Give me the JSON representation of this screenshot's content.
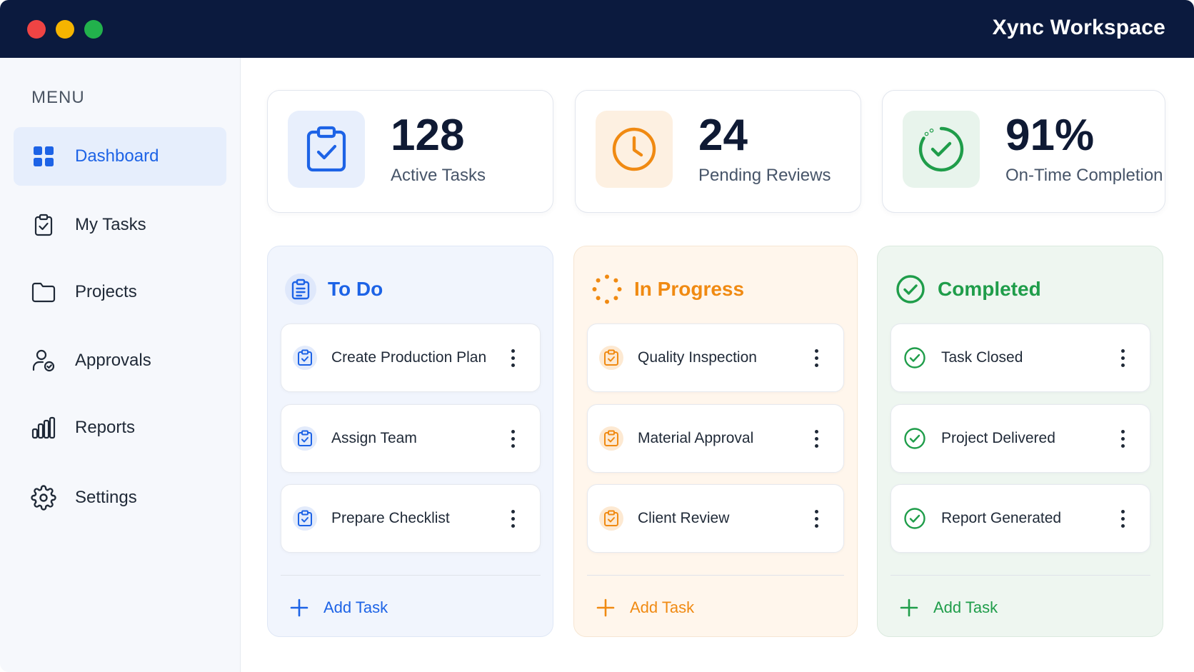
{
  "window": {
    "title": "Xync Workspace"
  },
  "sidebar": {
    "menu_label": "MENU",
    "items": [
      {
        "label": "Dashboard",
        "icon": "grid-icon",
        "active": true
      },
      {
        "label": "My Tasks",
        "icon": "clipboard-check-icon",
        "active": false
      },
      {
        "label": "Projects",
        "icon": "folder-icon",
        "active": false
      },
      {
        "label": "Approvals",
        "icon": "user-check-icon",
        "active": false
      },
      {
        "label": "Reports",
        "icon": "bar-chart-icon",
        "active": false
      },
      {
        "label": "Settings",
        "icon": "gear-icon",
        "active": false
      }
    ]
  },
  "stats": [
    {
      "value": "128",
      "label": "Active Tasks",
      "icon": "clipboard-check-icon",
      "color": "#1d63e6"
    },
    {
      "value": "24",
      "label": "Pending Reviews",
      "icon": "clock-icon",
      "color": "#f08a12"
    },
    {
      "value": "91%",
      "label": "On-Time Completion",
      "icon": "check-circle-icon",
      "color": "#1f9d4a"
    }
  ],
  "columns": [
    {
      "title": "To Do",
      "color": "#1d63e6",
      "header_icon": "clipboard-list-icon",
      "tasks": [
        "Create Production Plan",
        "Assign Team",
        "Prepare Checklist"
      ],
      "add_label": "Add Task"
    },
    {
      "title": "In Progress",
      "color": "#f08a12",
      "header_icon": "spinner-icon",
      "tasks": [
        "Quality Inspection",
        "Material Approval",
        "Client Review"
      ],
      "add_label": "Add Task"
    },
    {
      "title": "Completed",
      "color": "#1f9d4a",
      "header_icon": "check-circle-icon",
      "tasks": [
        "Task Closed",
        "Project Delivered",
        "Report Generated"
      ],
      "add_label": "Add Task"
    }
  ]
}
